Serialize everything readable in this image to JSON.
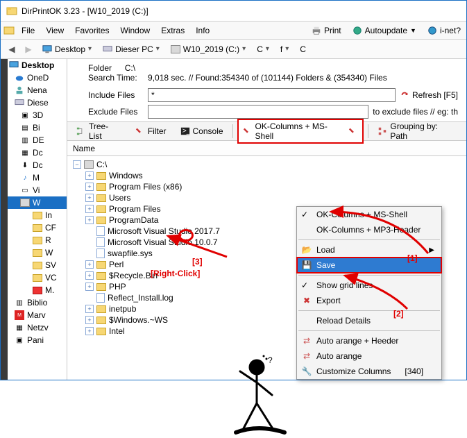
{
  "title": "DirPrintOK 3.23 - [W10_2019 (C:)]",
  "menu": {
    "file": "File",
    "view": "View",
    "favorites": "Favorites",
    "window": "Window",
    "extras": "Extras",
    "info": "Info"
  },
  "rmenu": {
    "print": "Print",
    "autoupdate": "Autoupdate",
    "inet": "i-net?"
  },
  "crumbs": {
    "desktop": "Desktop",
    "pc": "Dieser PC",
    "drive": "W10_2019 (C:)",
    "root": "C",
    "f": "f",
    "c": "C"
  },
  "sidebar": {
    "items": [
      {
        "label": "Desktop"
      },
      {
        "label": "OneD"
      },
      {
        "label": "Nena"
      },
      {
        "label": "Diese"
      },
      {
        "label": "3D"
      },
      {
        "label": "Bi"
      },
      {
        "label": "DE"
      },
      {
        "label": "Dc"
      },
      {
        "label": "Dc"
      },
      {
        "label": "M"
      },
      {
        "label": "Vi"
      },
      {
        "label": "W"
      },
      {
        "label": "In"
      },
      {
        "label": "CF"
      },
      {
        "label": "R"
      },
      {
        "label": "W"
      },
      {
        "label": "SV"
      },
      {
        "label": "VC"
      },
      {
        "label": "M."
      },
      {
        "label": "Biblio"
      },
      {
        "label": "Marv"
      },
      {
        "label": "Netzv"
      },
      {
        "label": "Pani"
      }
    ]
  },
  "meta": {
    "folder_lbl": "Folder",
    "folder_val": "C:\\",
    "search_lbl": "Search Time:",
    "search_val": "9,018 sec. //   Found:354340 of (101144) Folders & (354340) Files"
  },
  "filters": {
    "include_lbl": "Include Files",
    "include_val": "*",
    "include_after": "Refresh [F5]",
    "exclude_lbl": "Exclude Files",
    "exclude_val": "",
    "exclude_after": "to exclude files // eg: th"
  },
  "toolbar": {
    "treelist": "Tree-List",
    "filter": "Filter",
    "console": "Console",
    "columns_btn": "OK-Columns + MS-Shell",
    "grouping": "Grouping by: Path"
  },
  "colhdr": {
    "name": "Name"
  },
  "tree": {
    "root": "C:\\",
    "items": [
      {
        "t": "f",
        "label": "Windows"
      },
      {
        "t": "f",
        "label": "Program Files (x86)"
      },
      {
        "t": "f",
        "label": "Users"
      },
      {
        "t": "f",
        "label": "Program Files"
      },
      {
        "t": "f",
        "label": "ProgramData"
      },
      {
        "t": "d",
        "label": "Microsoft Visual Studio 2017.7"
      },
      {
        "t": "d",
        "label": "Microsoft Visual Studio 10.0.7"
      },
      {
        "t": "d",
        "label": "swapfile.sys"
      },
      {
        "t": "f",
        "label": "Perl"
      },
      {
        "t": "f",
        "label": "$Recycle.Bin"
      },
      {
        "t": "f",
        "label": "PHP"
      },
      {
        "t": "d",
        "label": "Reflect_Install.log"
      },
      {
        "t": "f",
        "label": "inetpub"
      },
      {
        "t": "f",
        "label": "$Windows.~WS"
      },
      {
        "t": "f",
        "label": "Intel"
      }
    ]
  },
  "ctx": {
    "opt1": "OK-Columns + MS-Shell",
    "opt2": "OK-Columns + MP3-Header",
    "load": "Load",
    "save": "Save",
    "grid": "Show grid lines",
    "export": "Export",
    "reload": "Reload Details",
    "auto1": "Auto arange + Heeder",
    "auto2": "Auto arange",
    "custom": "Customize Columns",
    "custom_n": "[340]"
  },
  "anno": {
    "a1": "[1]",
    "a2": "[2]",
    "a3": "[3]",
    "rc": "[Right-Click]"
  }
}
